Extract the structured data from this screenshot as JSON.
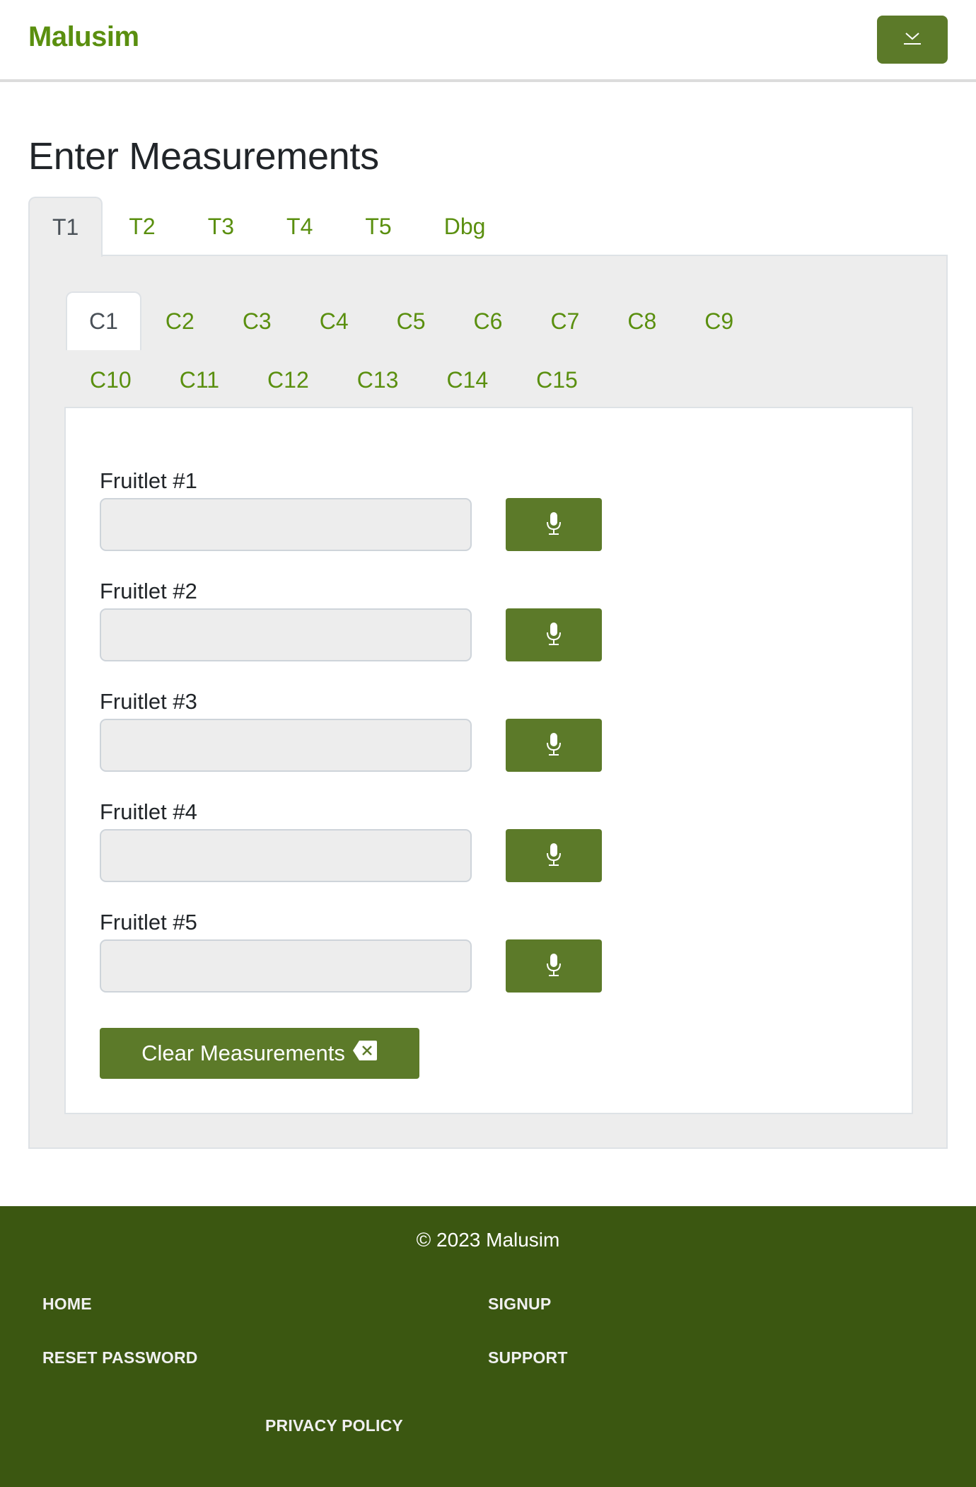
{
  "header": {
    "logo": "Malusim",
    "menu_button_icon": "download-chevron-icon"
  },
  "page": {
    "title": "Enter Measurements"
  },
  "outer_tabs": [
    {
      "label": "T1",
      "active": true
    },
    {
      "label": "T2",
      "active": false
    },
    {
      "label": "T3",
      "active": false
    },
    {
      "label": "T4",
      "active": false
    },
    {
      "label": "T5",
      "active": false
    },
    {
      "label": "Dbg",
      "active": false
    }
  ],
  "inner_tabs": {
    "row1": [
      {
        "label": "C1",
        "active": true
      },
      {
        "label": "C2",
        "active": false
      },
      {
        "label": "C3",
        "active": false
      },
      {
        "label": "C4",
        "active": false
      },
      {
        "label": "C5",
        "active": false
      },
      {
        "label": "C6",
        "active": false
      },
      {
        "label": "C7",
        "active": false
      },
      {
        "label": "C8",
        "active": false
      },
      {
        "label": "C9",
        "active": false
      }
    ],
    "row2": [
      {
        "label": "C10",
        "active": false
      },
      {
        "label": "C11",
        "active": false
      },
      {
        "label": "C12",
        "active": false
      },
      {
        "label": "C13",
        "active": false
      },
      {
        "label": "C14",
        "active": false
      },
      {
        "label": "C15",
        "active": false
      }
    ]
  },
  "fields": [
    {
      "label": "Fruitlet #1",
      "value": "",
      "mic_icon": "microphone-icon"
    },
    {
      "label": "Fruitlet #2",
      "value": "",
      "mic_icon": "microphone-icon"
    },
    {
      "label": "Fruitlet #3",
      "value": "",
      "mic_icon": "microphone-icon"
    },
    {
      "label": "Fruitlet #4",
      "value": "",
      "mic_icon": "microphone-icon"
    },
    {
      "label": "Fruitlet #5",
      "value": "",
      "mic_icon": "microphone-icon"
    }
  ],
  "actions": {
    "clear_label": "Clear Measurements",
    "clear_icon": "backspace-x-icon"
  },
  "footer": {
    "copyright": "© 2023 Malusim",
    "links": {
      "home": "HOME",
      "signup": "SIGNUP",
      "reset_password": "RESET PASSWORD",
      "support": "SUPPORT",
      "privacy_policy": "PRIVACY POLICY"
    }
  },
  "colors": {
    "brand_green": "#5a8f0f",
    "button_green": "#5c7a29",
    "footer_green": "#3b5711",
    "panel_gray": "#ededed",
    "border_gray": "#dee2e6"
  }
}
